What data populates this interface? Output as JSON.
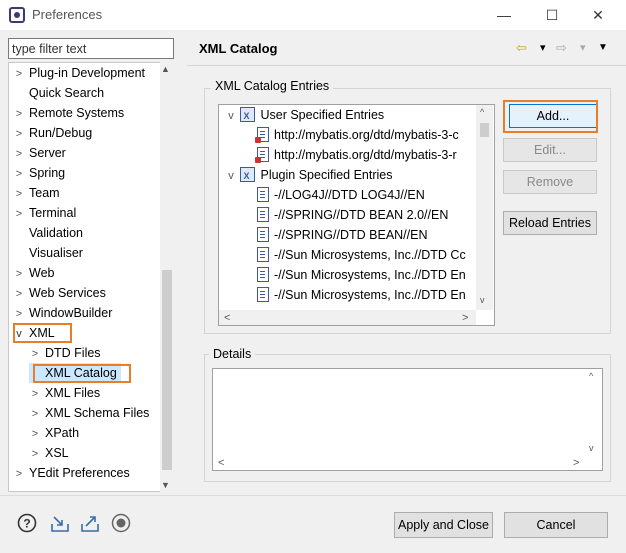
{
  "window": {
    "title": "Preferences",
    "minimize_glyph": "—",
    "maximize_glyph": "☐",
    "close_glyph": "✕"
  },
  "filter": {
    "placeholder": "type filter text"
  },
  "tree": [
    {
      "label": "Plug-in Development",
      "twisty": ">"
    },
    {
      "label": "Quick Search",
      "twisty": ""
    },
    {
      "label": "Remote Systems",
      "twisty": ">"
    },
    {
      "label": "Run/Debug",
      "twisty": ">"
    },
    {
      "label": "Server",
      "twisty": ">"
    },
    {
      "label": "Spring",
      "twisty": ">"
    },
    {
      "label": "Team",
      "twisty": ">"
    },
    {
      "label": "Terminal",
      "twisty": ">"
    },
    {
      "label": "Validation",
      "twisty": ""
    },
    {
      "label": "Visualiser",
      "twisty": ""
    },
    {
      "label": "Web",
      "twisty": ">"
    },
    {
      "label": "Web Services",
      "twisty": ">"
    },
    {
      "label": "WindowBuilder",
      "twisty": ">"
    },
    {
      "label": "XML",
      "twisty": "v"
    },
    {
      "label": "DTD Files",
      "twisty": ">"
    },
    {
      "label": "XML Catalog",
      "twisty": ""
    },
    {
      "label": "XML Files",
      "twisty": ">"
    },
    {
      "label": "XML Schema Files",
      "twisty": ">"
    },
    {
      "label": "XPath",
      "twisty": ">"
    },
    {
      "label": "XSL",
      "twisty": ">"
    },
    {
      "label": "YEdit Preferences",
      "twisty": ">"
    }
  ],
  "page": {
    "title": "XML Catalog",
    "back_glyph": "⇦",
    "forward_glyph": "⇨",
    "dropdown_glyph": "▾",
    "menu_glyph": "▼"
  },
  "entries": {
    "group_label": "XML Catalog Entries",
    "user_group": "User Specified Entries",
    "user_items": [
      "http://mybatis.org/dtd/mybatis-3-c",
      "http://mybatis.org/dtd/mybatis-3-r"
    ],
    "plugin_group": "Plugin Specified Entries",
    "plugin_items": [
      "-//LOG4J//DTD LOG4J//EN",
      "-//SPRING//DTD BEAN 2.0//EN",
      "-//SPRING//DTD BEAN//EN",
      "-//Sun Microsystems, Inc.//DTD Cc",
      "-//Sun Microsystems, Inc.//DTD En",
      "-//Sun Microsystems, Inc.//DTD En"
    ]
  },
  "buttons": {
    "add": "Add...",
    "edit": "Edit...",
    "remove": "Remove",
    "reload": "Reload Entries",
    "apply_close": "Apply and Close",
    "cancel": "Cancel"
  },
  "details": {
    "label": "Details"
  },
  "colors": {
    "highlight": "#e87d2a",
    "selection": "#cce8ff"
  }
}
